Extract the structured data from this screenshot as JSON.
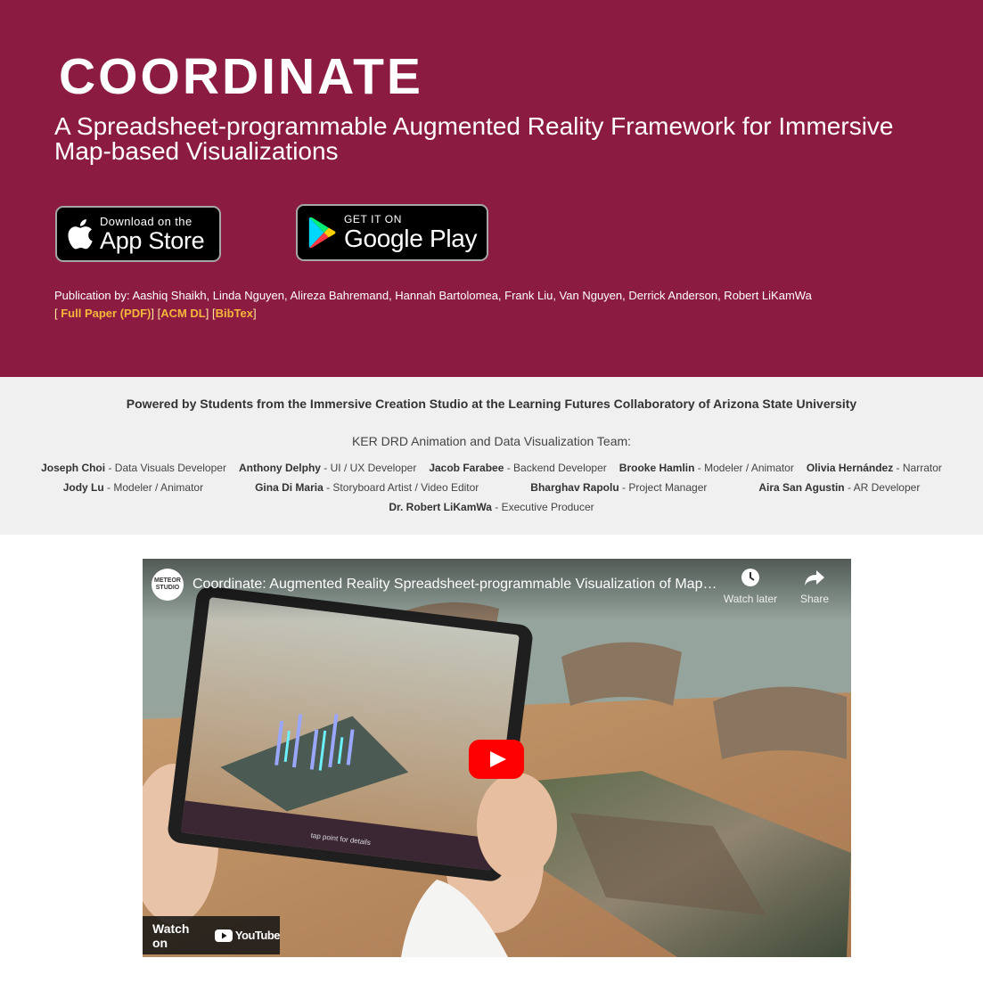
{
  "hero": {
    "title": "COORDINATE",
    "subtitle": "A Spreadsheet-programmable Augmented Reality Framework for Immersive Map-based Visualizations",
    "background_color": "#8c1b42",
    "app_store": {
      "small": "Download on the",
      "big": "App Store",
      "icon": "apple-icon"
    },
    "google_play": {
      "small": "GET IT ON",
      "big": "Google Play",
      "icon": "google-play-icon"
    },
    "publication": {
      "authors": "Publication by: Aashiq Shaikh, Linda Nguyen, Alireza Bahremand, Hannah Bartolomea, Frank Liu, Van Nguyen, Derrick Anderson, Robert LiKamWa",
      "links": [
        {
          "label": "Full Paper (PDF)"
        },
        {
          "label": "ACM DL"
        },
        {
          "label": "BibTex"
        }
      ],
      "link_color": "#f5b73b"
    }
  },
  "credits": {
    "powered_by": "Powered by Students from the Immersive Creation Studio at the Learning Futures Collaboratory of Arizona State University",
    "team_heading": "KER DRD Animation and Data Visualization Team:",
    "rows": [
      [
        {
          "name": "Joseph Choi",
          "role": " - Data Visuals Developer"
        },
        {
          "name": "Anthony Delphy",
          "role": " - UI / UX Developer"
        },
        {
          "name": "Jacob Farabee",
          "role": " - Backend Developer"
        },
        {
          "name": "Brooke Hamlin",
          "role": " - Modeler / Animator"
        },
        {
          "name": "Olivia Hernández",
          "role": " - Narrator"
        }
      ],
      [
        {
          "name": "Jody Lu",
          "role": " - Modeler / Animator"
        },
        {
          "name": "Gina Di Maria",
          "role": " - Storyboard Artist / Video Editor"
        },
        {
          "name": "Bharghav Rapolu",
          "role": " - Project Manager"
        },
        {
          "name": "Aira San Agustin",
          "role": " - AR Developer"
        }
      ],
      [
        {
          "name": "Dr. Robert LiKamWa",
          "role": " - Executive Producer"
        }
      ]
    ]
  },
  "video": {
    "channel_logo_text": "METEOR STUDIO",
    "title": "Coordinate: Augmented Reality Spreadsheet-programmable Visualization of Map-based Data",
    "watch_later": "Watch later",
    "share": "Share",
    "watch_on": "Watch on",
    "youtube_word": "YouTube",
    "tablet_hint": "tap point for details",
    "youtube_red": "#ff0000"
  }
}
